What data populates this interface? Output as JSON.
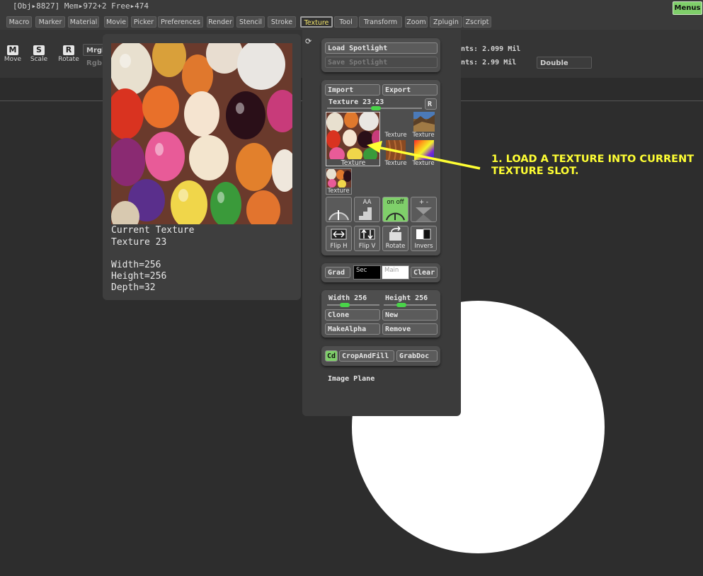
{
  "status": {
    "text": "[Obj▸8827] Mem▸972+2 Free▸474"
  },
  "menus_button": "Menus",
  "menubar": {
    "items": [
      "Macro",
      "Marker",
      "Material",
      "Movie",
      "Picker",
      "Preferences",
      "Render",
      "Stencil",
      "Stroke",
      "Texture",
      "Tool",
      "Transform",
      "Zoom",
      "Zplugin",
      "Zscript"
    ],
    "active": "Texture"
  },
  "toolbar": {
    "move": {
      "icon": "M",
      "label": "Move"
    },
    "scale": {
      "icon": "S",
      "label": "Scale"
    },
    "rotate": {
      "icon": "R",
      "label": "Rotate"
    },
    "mrgb": "Mrgb",
    "rgb": "Rgb",
    "points1": "nts: 2.099 Mil",
    "points2": "nts: 2.99 Mil",
    "double": "Double"
  },
  "preview": {
    "line1": "Current Texture",
    "line2": "Texture 23",
    "width": "Width=256",
    "height": "Height=256",
    "depth": "Depth=32"
  },
  "palette": {
    "load_spotlight": "Load Spotlight",
    "save_spotlight": "Save Spotlight",
    "import": "Import",
    "export": "Export",
    "texture_slider_label": "Texture 23.",
    "texture_slider_value": "23",
    "r_button": "R",
    "slots": [
      "Texture",
      "Texture",
      "Texture",
      "Texture",
      "Texture",
      "Texture"
    ],
    "onoff_label": "on  off",
    "arith_label": "+  -",
    "flip_h": "Flip H",
    "flip_v": "Flip V",
    "rotate": "Rotate",
    "invers": "Invers",
    "grad": "Grad",
    "sec": "Sec",
    "main": "Main",
    "clear": "Clear",
    "width_label": "Width 256",
    "height_label": "Height 256",
    "clone": "Clone",
    "new": "New",
    "makealpha": "MakeAlpha",
    "remove": "Remove",
    "cd": "Cd",
    "cropandfill": "CropAndFill",
    "grabdoc": "GrabDoc",
    "image_plane": "Image Plane"
  },
  "annotation": {
    "line1": "1. LOAD A TEXTURE INTO CURRENT",
    "line2": "TEXTURE SLOT.",
    "color": "#ffff33"
  }
}
